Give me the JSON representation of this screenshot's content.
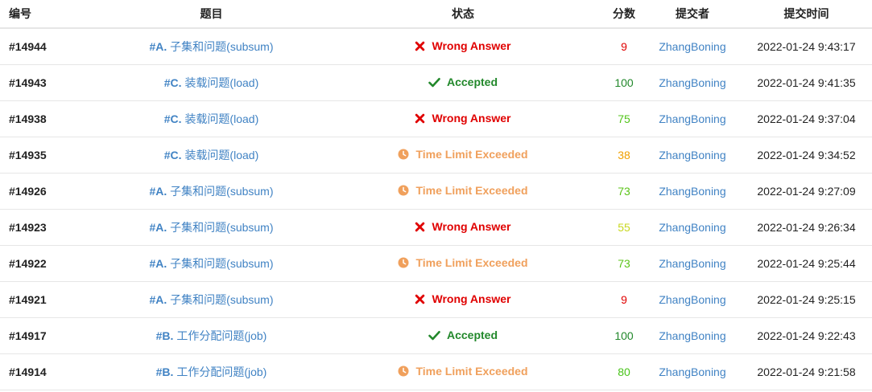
{
  "headers": {
    "id": "编号",
    "problem": "题目",
    "status": "状态",
    "score": "分数",
    "submitter": "提交者",
    "time": "提交时间"
  },
  "status_styles": {
    "Wrong Answer": {
      "icon": "x-icon",
      "color": "#e00000",
      "cls": "st-wrong"
    },
    "Accepted": {
      "icon": "check-icon",
      "color": "#22882b",
      "cls": "st-ok"
    },
    "Time Limit Exceeded": {
      "icon": "clock-icon",
      "color": "#f0a05c",
      "cls": "st-tle"
    }
  },
  "rows": [
    {
      "id": "#14944",
      "problem_code": "#A.",
      "problem_name": "子集和问题(subsum)",
      "status": "Wrong Answer",
      "score": "9",
      "score_color": "#e00000",
      "submitter": "ZhangBoning",
      "time": "2022-01-24 9:43:17"
    },
    {
      "id": "#14943",
      "problem_code": "#C.",
      "problem_name": "装载问题(load)",
      "status": "Accepted",
      "score": "100",
      "score_color": "#22882b",
      "submitter": "ZhangBoning",
      "time": "2022-01-24 9:41:35"
    },
    {
      "id": "#14938",
      "problem_code": "#C.",
      "problem_name": "装载问题(load)",
      "status": "Wrong Answer",
      "score": "75",
      "score_color": "#52c41a",
      "submitter": "ZhangBoning",
      "time": "2022-01-24 9:37:04"
    },
    {
      "id": "#14935",
      "problem_code": "#C.",
      "problem_name": "装载问题(load)",
      "status": "Time Limit Exceeded",
      "score": "38",
      "score_color": "#f0a000",
      "submitter": "ZhangBoning",
      "time": "2022-01-24 9:34:52"
    },
    {
      "id": "#14926",
      "problem_code": "#A.",
      "problem_name": "子集和问题(subsum)",
      "status": "Time Limit Exceeded",
      "score": "73",
      "score_color": "#5cc41a",
      "submitter": "ZhangBoning",
      "time": "2022-01-24 9:27:09"
    },
    {
      "id": "#14923",
      "problem_code": "#A.",
      "problem_name": "子集和问题(subsum)",
      "status": "Wrong Answer",
      "score": "55",
      "score_color": "#c8d820",
      "submitter": "ZhangBoning",
      "time": "2022-01-24 9:26:34"
    },
    {
      "id": "#14922",
      "problem_code": "#A.",
      "problem_name": "子集和问题(subsum)",
      "status": "Time Limit Exceeded",
      "score": "73",
      "score_color": "#5cc41a",
      "submitter": "ZhangBoning",
      "time": "2022-01-24 9:25:44"
    },
    {
      "id": "#14921",
      "problem_code": "#A.",
      "problem_name": "子集和问题(subsum)",
      "status": "Wrong Answer",
      "score": "9",
      "score_color": "#e00000",
      "submitter": "ZhangBoning",
      "time": "2022-01-24 9:25:15"
    },
    {
      "id": "#14917",
      "problem_code": "#B.",
      "problem_name": "工作分配问题(job)",
      "status": "Accepted",
      "score": "100",
      "score_color": "#22882b",
      "submitter": "ZhangBoning",
      "time": "2022-01-24 9:22:43"
    },
    {
      "id": "#14914",
      "problem_code": "#B.",
      "problem_name": "工作分配问题(job)",
      "status": "Time Limit Exceeded",
      "score": "80",
      "score_color": "#48c41a",
      "submitter": "ZhangBoning",
      "time": "2022-01-24 9:21:58"
    }
  ]
}
